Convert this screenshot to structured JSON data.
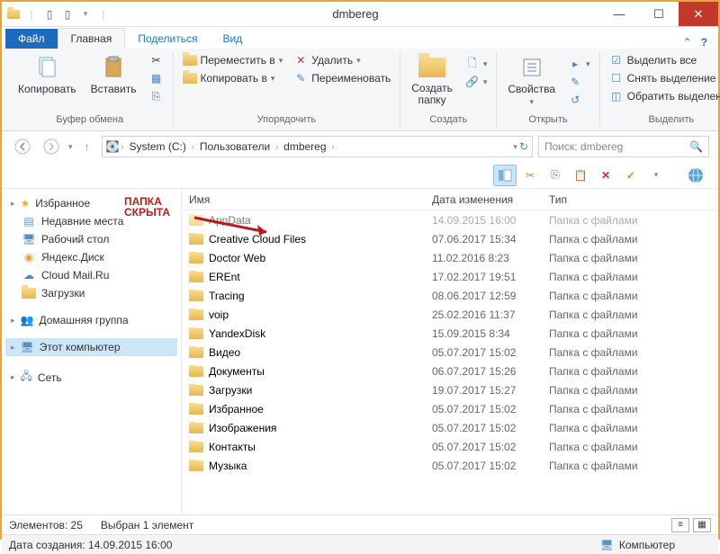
{
  "window": {
    "title": "dmbereg"
  },
  "tabs": {
    "file": "Файл",
    "home": "Главная",
    "share": "Поделиться",
    "view": "Вид"
  },
  "ribbon": {
    "clipboard": {
      "copy": "Копировать",
      "paste": "Вставить",
      "label": "Буфер обмена"
    },
    "organize": {
      "move_to": "Переместить в",
      "copy_to": "Копировать в",
      "delete": "Удалить",
      "rename": "Переименовать",
      "label": "Упорядочить"
    },
    "new": {
      "new_folder": "Создать\nпапку",
      "label": "Создать"
    },
    "open": {
      "properties": "Свойства",
      "label": "Открыть"
    },
    "select": {
      "select_all": "Выделить все",
      "select_none": "Снять выделение",
      "invert": "Обратить выделение",
      "label": "Выделить"
    }
  },
  "breadcrumb": {
    "seg1": "System (C:)",
    "seg2": "Пользователи",
    "seg3": "dmbereg"
  },
  "search": {
    "placeholder": "Поиск: dmbereg"
  },
  "sidebar": {
    "favorites": "Избранное",
    "items": [
      "Недавние места",
      "Рабочий стол",
      "Яндекс.Диск",
      "Cloud Mail.Ru",
      "Загрузки"
    ],
    "homegroup": "Домашняя группа",
    "this_pc": "Этот компьютер",
    "network": "Сеть"
  },
  "columns": {
    "name": "Имя",
    "date": "Дата изменения",
    "type": "Тип"
  },
  "type_folder": "Папка с файлами",
  "files": [
    {
      "name": "AppData",
      "date": "14.09.2015 16:00",
      "hidden": true
    },
    {
      "name": "Creative Cloud Files",
      "date": "07.06.2017 15:34"
    },
    {
      "name": "Doctor Web",
      "date": "11.02.2016 8:23"
    },
    {
      "name": "EREnt",
      "date": "17.02.2017 19:51"
    },
    {
      "name": "Tracing",
      "date": "08.06.2017 12:59"
    },
    {
      "name": "voip",
      "date": "25.02.2016 11:37"
    },
    {
      "name": "YandexDisk",
      "date": "15.09.2015 8:34"
    },
    {
      "name": "Видео",
      "date": "05.07.2017 15:02"
    },
    {
      "name": "Документы",
      "date": "06.07.2017 15:26"
    },
    {
      "name": "Загрузки",
      "date": "19.07.2017 15:27"
    },
    {
      "name": "Избранное",
      "date": "05.07.2017 15:02"
    },
    {
      "name": "Изображения",
      "date": "05.07.2017 15:02"
    },
    {
      "name": "Контакты",
      "date": "05.07.2017 15:02"
    },
    {
      "name": "Музыка",
      "date": "05.07.2017 15:02"
    }
  ],
  "status": {
    "count": "Элементов: 25",
    "selected": "Выбран 1 элемент",
    "created": "Дата создания: 14.09.2015 16:00",
    "computer": "Компьютер"
  },
  "annotation": {
    "line1": "ПАПКА",
    "line2": "СКРЫТА"
  }
}
